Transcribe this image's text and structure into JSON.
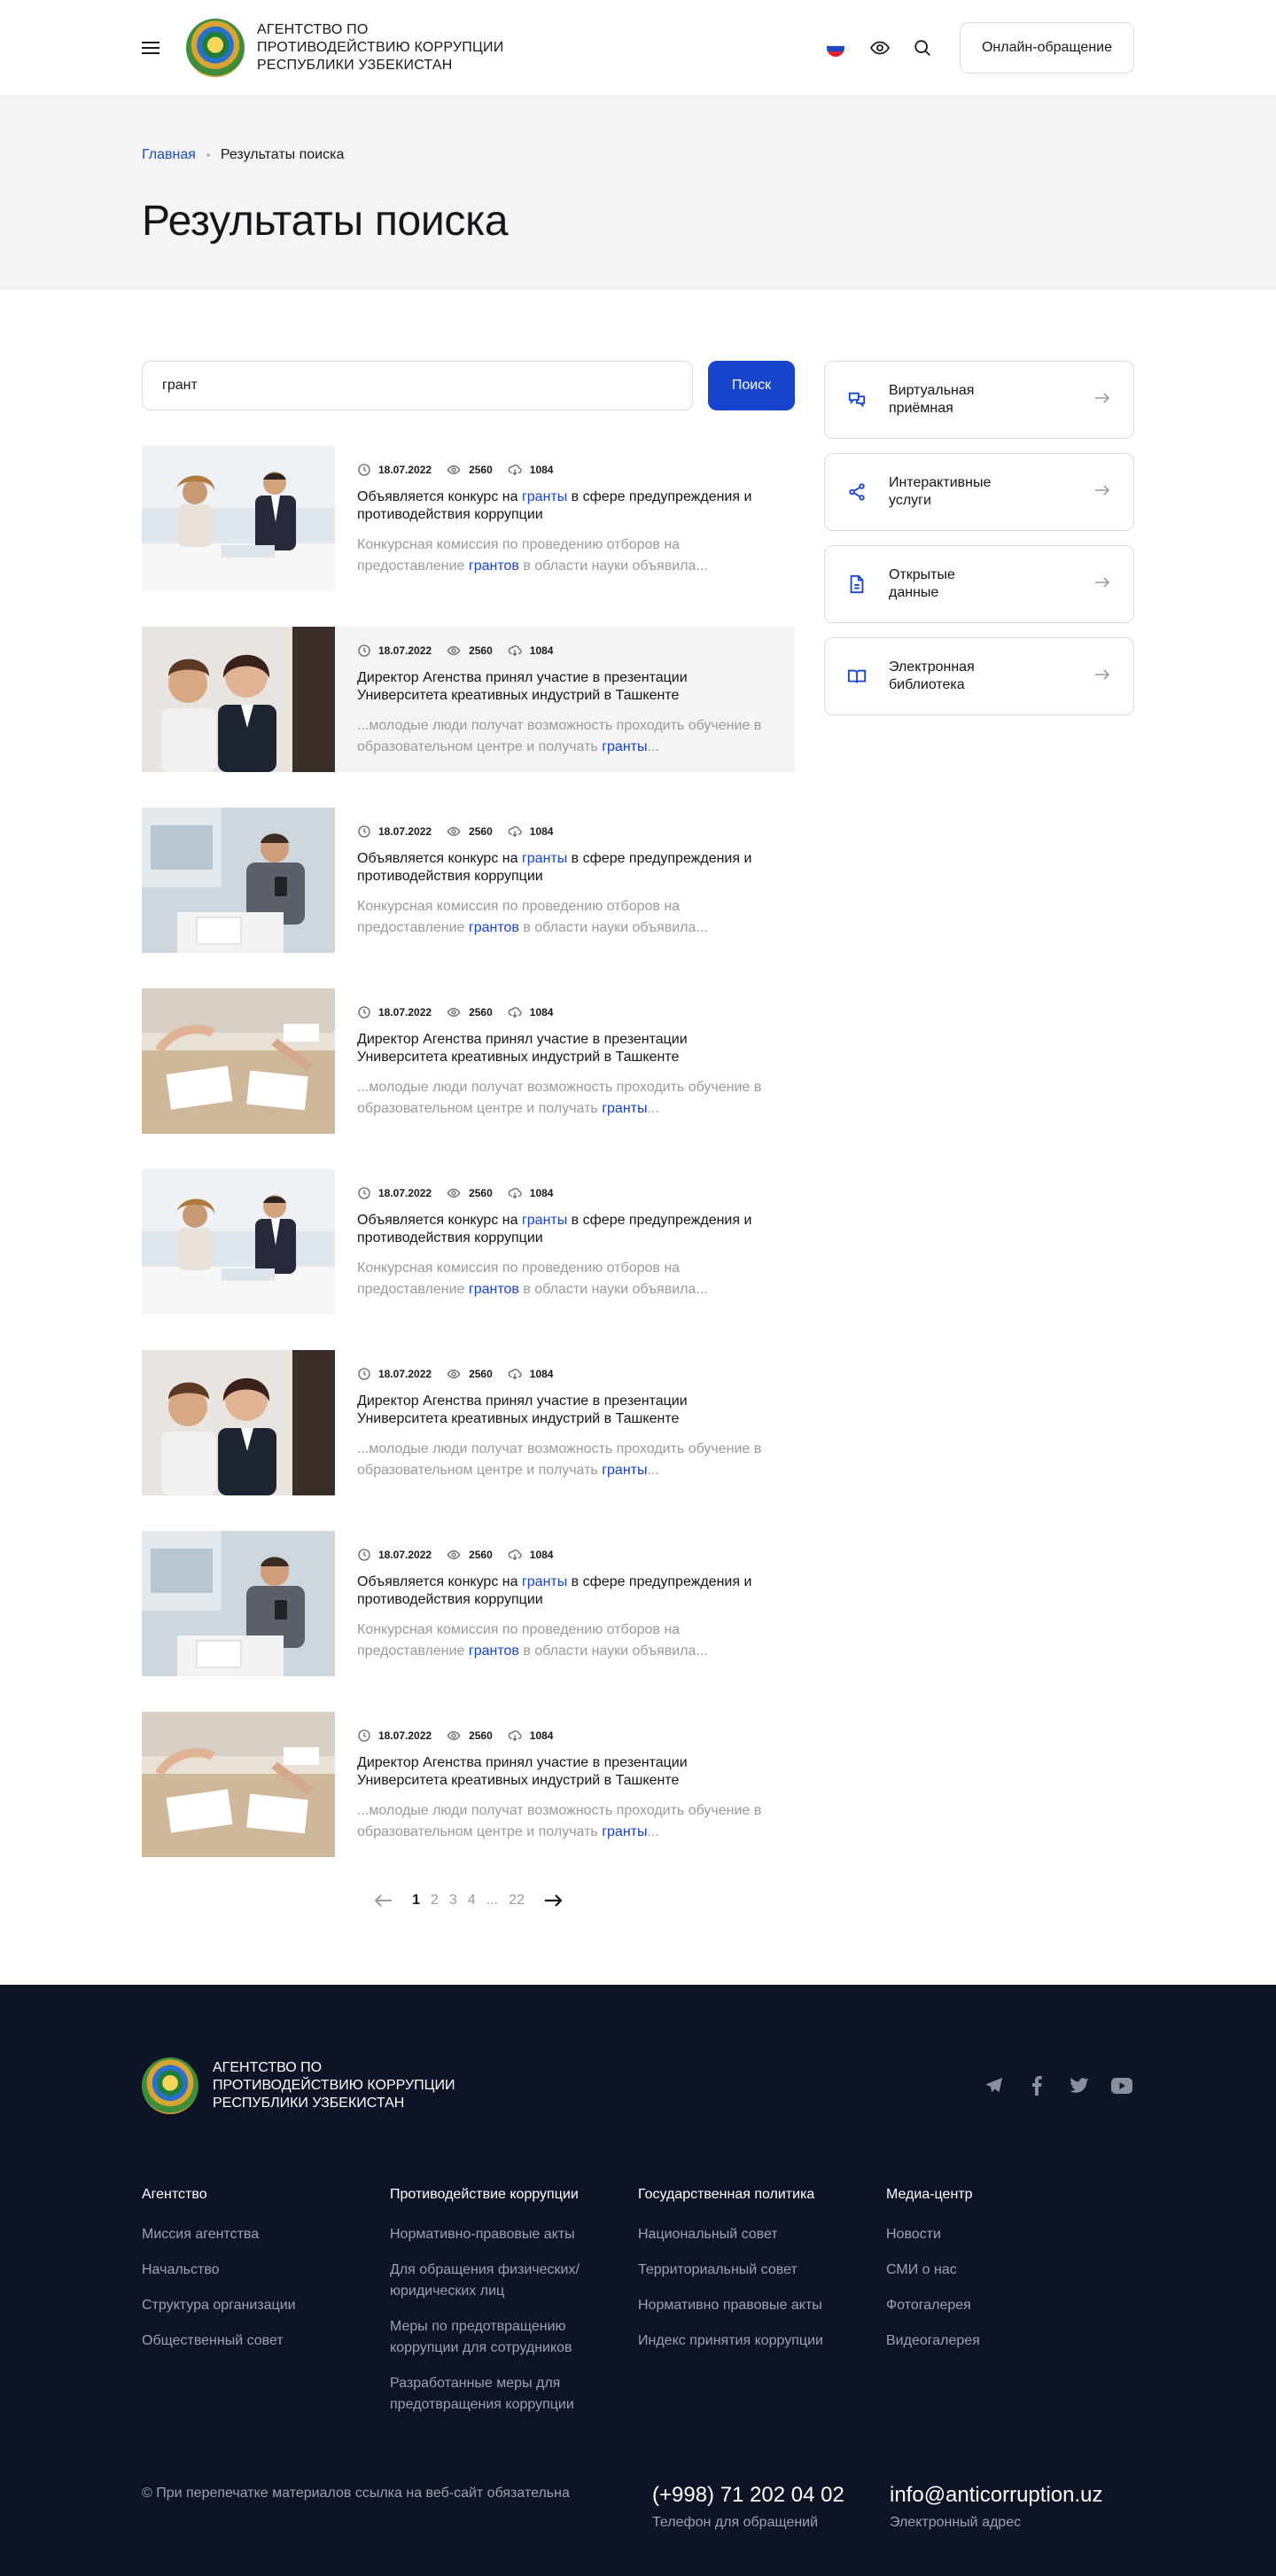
{
  "header": {
    "agency_line1": "Агентство по",
    "agency_line2": "противодействию коррупции",
    "agency_line3": "Республики Узбекистан",
    "online_button": "Онлайн-обращение"
  },
  "breadcrumb": {
    "home": "Главная",
    "current": "Результаты поиска"
  },
  "page_title": "Результаты поиска",
  "search": {
    "value": "грант",
    "button": "Поиск"
  },
  "results": [
    {
      "date": "18.07.2022",
      "views": "2560",
      "downloads": "1084",
      "title_pre": "Объявляется конкурс на ",
      "title_hl": "гранты",
      "title_post": " в сфере предупреждения и противодействия коррупции",
      "desc_pre": "Конкурсная комиссия по проведению отборов на предоставление ",
      "desc_hl": "грантов",
      "desc_post": " в области науки объявила..."
    },
    {
      "date": "18.07.2022",
      "views": "2560",
      "downloads": "1084",
      "title_pre": "Директор Агенства принял участие в презентации Университета креативных индустрий в Ташкенте",
      "title_hl": "",
      "title_post": "",
      "desc_pre": "...молодые люди получат возможность проходить обучение в образовательном центре и получать ",
      "desc_hl": "гранты",
      "desc_post": "..."
    },
    {
      "date": "18.07.2022",
      "views": "2560",
      "downloads": "1084",
      "title_pre": "Объявляется конкурс на ",
      "title_hl": "гранты",
      "title_post": " в сфере предупреждения и противодействия коррупции",
      "desc_pre": "Конкурсная комиссия по проведению отборов на предоставление ",
      "desc_hl": "грантов",
      "desc_post": " в области науки объявила..."
    },
    {
      "date": "18.07.2022",
      "views": "2560",
      "downloads": "1084",
      "title_pre": "Директор Агенства принял участие в презентации Университета креативных индустрий в Ташкенте",
      "title_hl": "",
      "title_post": "",
      "desc_pre": "...молодые люди получат возможность проходить обучение в образовательном центре и получать ",
      "desc_hl": "гранты",
      "desc_post": "..."
    },
    {
      "date": "18.07.2022",
      "views": "2560",
      "downloads": "1084",
      "title_pre": "Объявляется конкурс на ",
      "title_hl": "гранты",
      "title_post": " в сфере предупреждения и противодействия коррупции",
      "desc_pre": "Конкурсная комиссия по проведению отборов на предоставление ",
      "desc_hl": "грантов",
      "desc_post": " в области науки объявила..."
    },
    {
      "date": "18.07.2022",
      "views": "2560",
      "downloads": "1084",
      "title_pre": "Директор Агенства принял участие в презентации Университета креативных индустрий в Ташкенте",
      "title_hl": "",
      "title_post": "",
      "desc_pre": "...молодые люди получат возможность проходить обучение в образовательном центре и получать ",
      "desc_hl": "гранты",
      "desc_post": "..."
    },
    {
      "date": "18.07.2022",
      "views": "2560",
      "downloads": "1084",
      "title_pre": "Объявляется конкурс на ",
      "title_hl": "гранты",
      "title_post": " в сфере предупреждения и противодействия коррупции",
      "desc_pre": "Конкурсная комиссия по проведению отборов на предоставление ",
      "desc_hl": "грантов",
      "desc_post": " в области науки объявила..."
    },
    {
      "date": "18.07.2022",
      "views": "2560",
      "downloads": "1084",
      "title_pre": "Директор Агенства принял участие в презентации Университета креативных индустрий в Ташкенте",
      "title_hl": "",
      "title_post": "",
      "desc_pre": "...молодые люди получат возможность проходить обучение в образовательном центре и получать ",
      "desc_hl": "гранты",
      "desc_post": "..."
    }
  ],
  "pagination": {
    "pages": [
      "1",
      "2",
      "3",
      "4",
      "...",
      "22"
    ],
    "current": "1"
  },
  "sidebar": [
    {
      "line1": "Виртуальная",
      "line2": "приёмная",
      "icon": "chat-icon"
    },
    {
      "line1": "Интерактивные",
      "line2": "услуги",
      "icon": "share-icon"
    },
    {
      "line1": "Открытые",
      "line2": "данные",
      "icon": "document-icon"
    },
    {
      "line1": "Электронная",
      "line2": "библиотека",
      "icon": "book-icon"
    }
  ],
  "footer": {
    "agency_line1": "Агентство по",
    "agency_line2": "противодействию коррупции",
    "agency_line3": "Республики Узбекистан",
    "columns": [
      {
        "title": "Агентство",
        "links": [
          "Миссия агентства",
          "Начальство",
          "Структура организации",
          "Общественный совет"
        ]
      },
      {
        "title": "Противодействие коррупции",
        "links": [
          "Нормативно-правовые акты",
          "Для обращения физических/ юридических лиц",
          "Меры по предотвращению коррупции для сотрудников",
          "Разработанные меры для предотвращения коррупции"
        ]
      },
      {
        "title": "Государственная политика",
        "links": [
          "Национальный совет",
          "Территориальный совет",
          "Нормативно правовые акты",
          "Индекс принятия коррупции"
        ]
      },
      {
        "title": "Медиа-центр",
        "links": [
          "Новости",
          "СМИ о нас",
          "Фотогалерея",
          "Видеогалерея"
        ]
      }
    ],
    "copyright": "© При перепечатке материалов ссылка на веб-сайт обязательна",
    "phone": "(+998) 71 202 04 02",
    "phone_label": "Телефон для обращений",
    "email": "info@anticorruption.uz",
    "email_label": "Электронный адрес"
  },
  "colors": {
    "accent": "#1645cc",
    "footer_bg": "#0e1325",
    "band_bg": "#f4f4f4"
  }
}
